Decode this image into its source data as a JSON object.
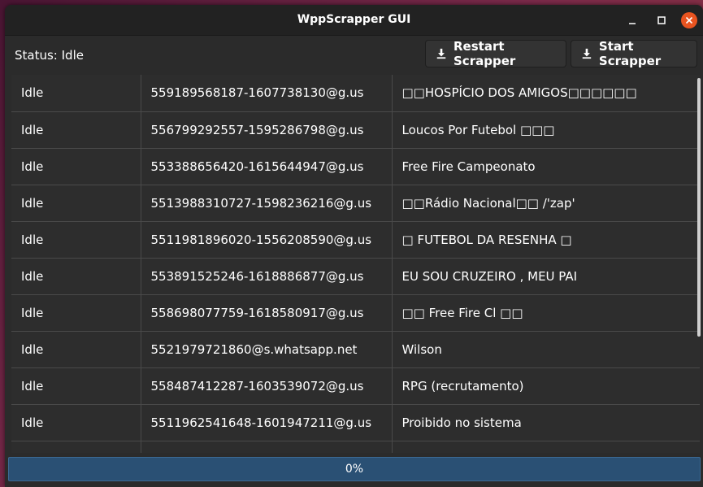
{
  "window": {
    "title": "WppScrapper GUI"
  },
  "toolbar": {
    "status_text": "Status: Idle",
    "restart_label": "Restart Scrapper",
    "start_label": "Start Scrapper"
  },
  "table": {
    "rows": [
      {
        "status": "Idle",
        "id": "559189568187-1607738130@g.us",
        "name": "□□HOSPÍCIO DOS AMIGOS□□□□□□"
      },
      {
        "status": "Idle",
        "id": "556799292557-1595286798@g.us",
        "name": "Loucos Por Futebol □□□"
      },
      {
        "status": "Idle",
        "id": "553388656420-1615644947@g.us",
        "name": "Free Fire Campeonato"
      },
      {
        "status": "Idle",
        "id": "5513988310727-1598236216@g.us",
        "name": "□□Rádio Nacional□□ /'zap'"
      },
      {
        "status": "Idle",
        "id": "5511981896020-1556208590@g.us",
        "name": "□ FUTEBOL DA RESENHA □"
      },
      {
        "status": "Idle",
        "id": "553891525246-1618886877@g.us",
        "name": "EU SOU CRUZEIRO , MEU PAI"
      },
      {
        "status": "Idle",
        "id": "558698077759-1618580917@g.us",
        "name": "□□ Free Fire Cl □□"
      },
      {
        "status": "Idle",
        "id": "5521979721860@s.whatsapp.net",
        "name": "Wilson"
      },
      {
        "status": "Idle",
        "id": "558487412287-1603539072@g.us",
        "name": "RPG (recrutamento)"
      },
      {
        "status": "Idle",
        "id": "5511962541648-1601947211@g.us",
        "name": "Proibido no sistema"
      },
      {
        "status": "",
        "id": "",
        "name": ""
      }
    ]
  },
  "progress": {
    "value": 0,
    "label": "0%"
  },
  "icons": {
    "download": "download-icon",
    "minimize": "minimize-icon",
    "maximize": "maximize-icon",
    "close": "close-icon"
  },
  "colors": {
    "accent_close": "#e95420",
    "progress_bar": "#2a5074"
  }
}
